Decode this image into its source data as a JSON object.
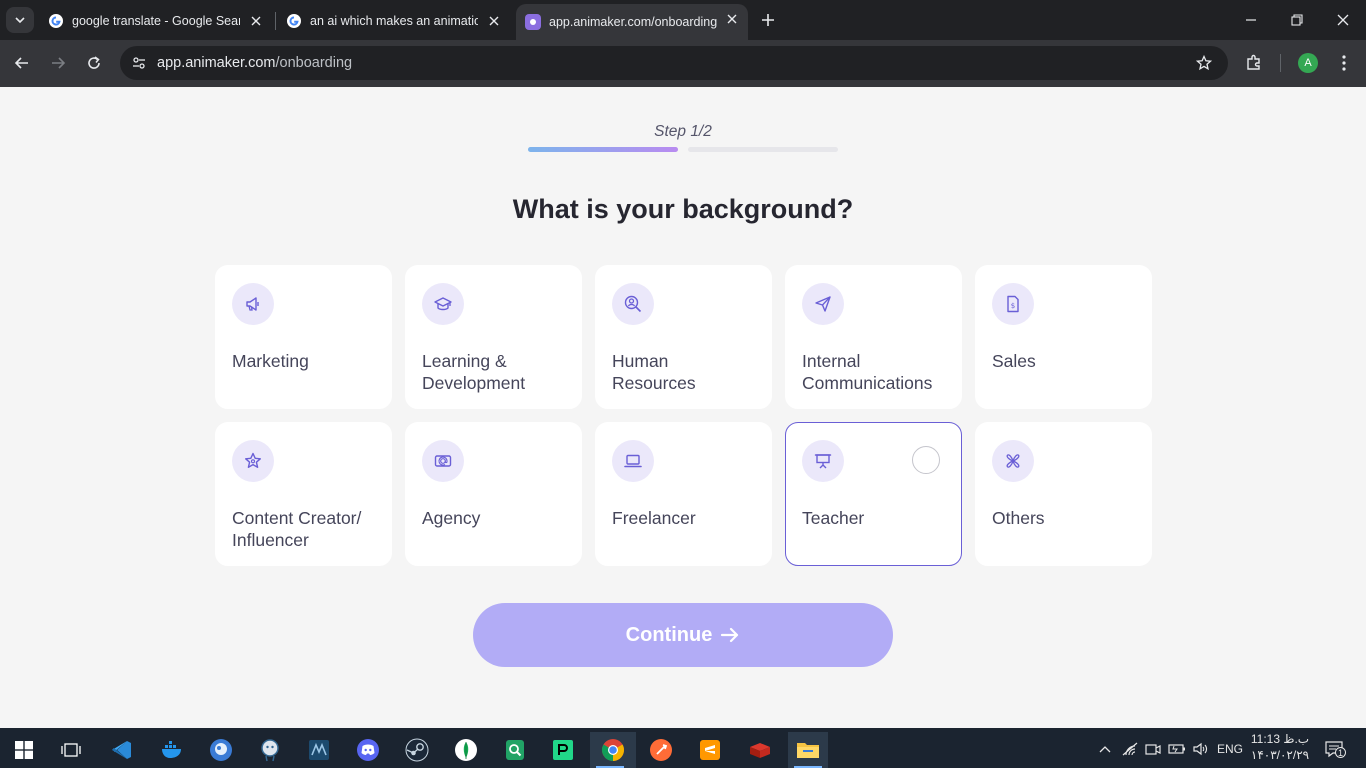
{
  "browser": {
    "tabs": [
      {
        "title": "google translate - Google Search",
        "favicon": "google-g-icon",
        "active": false
      },
      {
        "title": "an ai which makes an animation",
        "favicon": "google-g-icon",
        "active": false
      },
      {
        "title": "app.animaker.com/onboarding",
        "favicon": "animaker-icon",
        "active": true
      }
    ],
    "url_host": "app.animaker.com",
    "url_path": "/onboarding",
    "profile_initial": "A"
  },
  "onboarding": {
    "step_label": "Step 1/2",
    "progress_fraction": 0.5,
    "heading": "What is your background?",
    "options": [
      {
        "label": "Marketing",
        "icon": "megaphone-icon",
        "selected": false
      },
      {
        "label": "Learning &\nDevelopment",
        "icon": "graduation-cap-icon",
        "selected": false
      },
      {
        "label": "Human\nResources",
        "icon": "person-search-icon",
        "selected": false
      },
      {
        "label": "Internal\nCommunications",
        "icon": "paper-plane-icon",
        "selected": false
      },
      {
        "label": "Sales",
        "icon": "sales-document-icon",
        "selected": false
      },
      {
        "label": "Content Creator/\nInfluencer",
        "icon": "star-badge-icon",
        "selected": false
      },
      {
        "label": "Agency",
        "icon": "agency-screen-icon",
        "selected": false
      },
      {
        "label": "Freelancer",
        "icon": "laptop-icon",
        "selected": false
      },
      {
        "label": "Teacher",
        "icon": "presentation-board-icon",
        "selected": false,
        "hovered": true
      },
      {
        "label": "Others",
        "icon": "propeller-icon",
        "selected": false
      }
    ],
    "continue_label": "Continue"
  },
  "taskbar": {
    "apps": [
      "start-icon",
      "task-view-icon",
      "vscode-icon",
      "docker-icon",
      "app-icon",
      "postgresql-icon",
      "mysql-workbench-icon",
      "discord-icon",
      "steam-icon",
      "mongodb-icon",
      "sheets-icon",
      "pycharm-icon",
      "chrome-icon",
      "postman-icon",
      "sublime-icon",
      "redis-icon",
      "file-explorer-icon"
    ],
    "language": "ENG",
    "time": "11:13 ب.ظ",
    "date": "۱۴۰۳/۰۲/۲۹",
    "notification_count": "1"
  },
  "colors": {
    "accent": "#6a5fd6",
    "continue_bg": "#b2acf6",
    "icon_circle": "#ebe8fa",
    "page_bg": "#f5f5f5"
  }
}
